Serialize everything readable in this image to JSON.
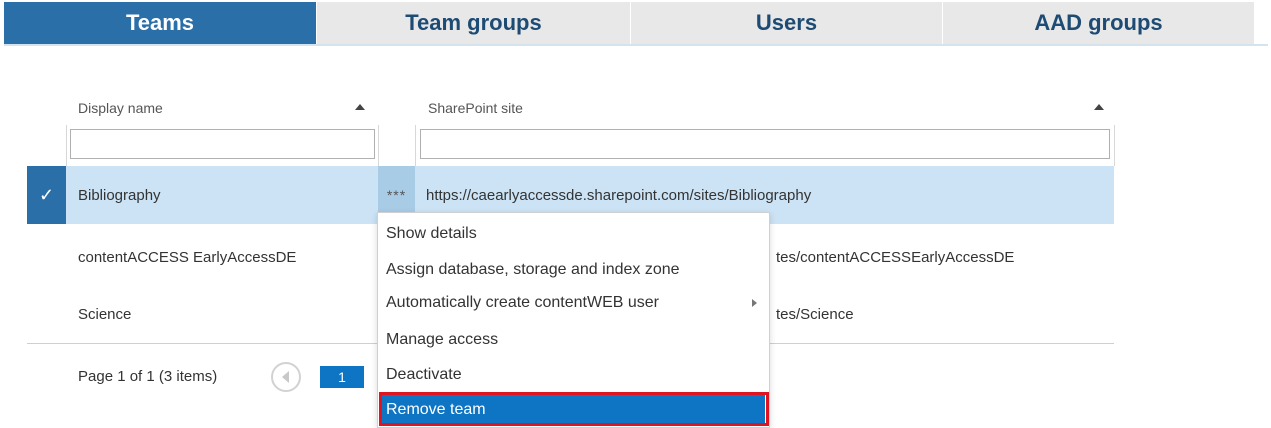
{
  "tabs": [
    "Teams",
    "Team groups",
    "Users",
    "AAD groups"
  ],
  "grid": {
    "columns": [
      "Display name",
      "SharePoint site"
    ],
    "rows": [
      {
        "name": "Bibliography",
        "site": "https://caearlyaccessde.sharepoint.com/sites/Bibliography",
        "selected": true
      },
      {
        "name": "contentACCESS EarlyAccessDE",
        "site": "tes/contentACCESSEarlyAccessDE",
        "selected": false
      },
      {
        "name": "Science",
        "site": "tes/Science",
        "selected": false
      }
    ],
    "filters": [
      "",
      ""
    ],
    "row_menu_label": "***",
    "check_icon": "check-icon"
  },
  "pager": {
    "info": "Page 1 of 1 (3 items)",
    "current_page": "1"
  },
  "context_menu": {
    "items": [
      "Show details",
      "Assign database, storage and index zone",
      "Automatically create contentWEB user",
      "Manage access",
      "Deactivate",
      "Remove team"
    ],
    "highlighted": "Remove team"
  },
  "colors": {
    "accent": "#2a6fa8",
    "selected_row": "#cbe3f5",
    "menu_highlight": "#0e74c4",
    "highlight_box": "#e01420"
  }
}
